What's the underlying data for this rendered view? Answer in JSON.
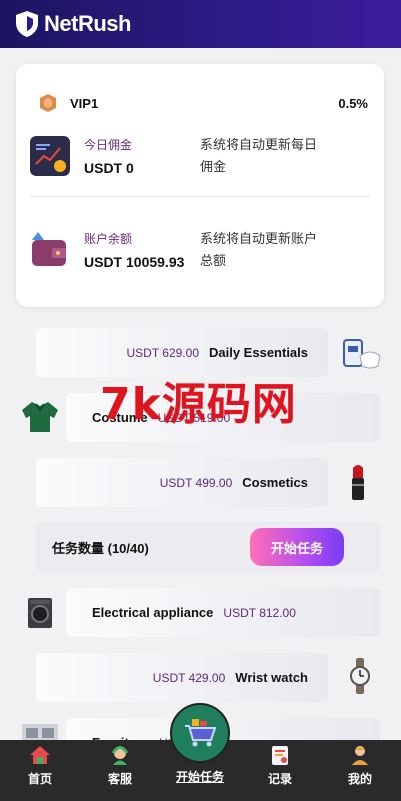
{
  "header": {
    "brand": "NetRush"
  },
  "account": {
    "vip_level": "VIP1",
    "vip_rate": "0.5%",
    "today_commission_title": "今日佣金",
    "today_commission_value": "USDT 0",
    "today_commission_note": "系统将自动更新每日佣金",
    "balance_title": "账户余额",
    "balance_value": "USDT 10059.93",
    "balance_note": "系统将自动更新账户总额"
  },
  "products": [
    {
      "name": "Daily Essentials",
      "price": "USDT 629.00"
    },
    {
      "name": "Costume",
      "price": "USDT 519.00"
    },
    {
      "name": "Cosmetics",
      "price": "USDT 499.00"
    },
    {
      "name": "Electrical appliance",
      "price": "USDT 812.00"
    },
    {
      "name": "Wrist watch",
      "price": "USDT 429.00"
    },
    {
      "name": "Furniture",
      "price": "USDT 6"
    }
  ],
  "task": {
    "label": "任务数量 (10/40)",
    "start_button": "开始任务"
  },
  "watermark": "7k源码网",
  "nav": {
    "home": "首页",
    "service": "客服",
    "start_task": "开始任务",
    "records": "记录",
    "mine": "我的"
  },
  "colors": {
    "header": "#2c1a85",
    "accent_text": "#5b2a7b",
    "nav_bg": "#2a2a2a",
    "start_button": "#b14ef0"
  }
}
